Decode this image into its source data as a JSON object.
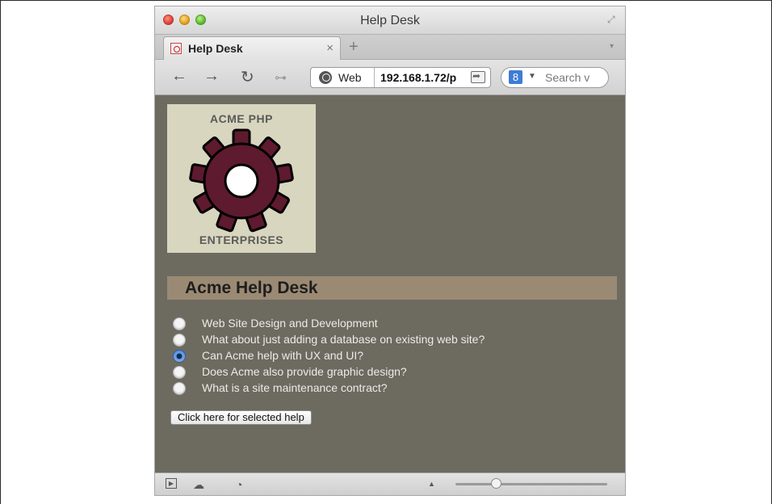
{
  "window": {
    "title": "Help Desk"
  },
  "tabs": [
    {
      "title": "Help Desk",
      "close_label": "×"
    }
  ],
  "tabbar": {
    "new_tab_label": "+",
    "menu_label": "▾"
  },
  "toolbar": {
    "back_label": "←",
    "forward_label": "→",
    "reload_label": "↻",
    "key_label": "⊶",
    "address": {
      "scheme_label": "Web",
      "url": "192.168.1.72/p"
    },
    "search": {
      "engine_label": "8",
      "placeholder": "Search v"
    }
  },
  "page": {
    "logo": {
      "top_text": "ACME PHP",
      "bottom_text": "ENTERPRISES",
      "gear_color": "#5e1a2e"
    },
    "heading": "Acme Help Desk",
    "options": [
      {
        "label": "Web Site Design and Development",
        "checked": false
      },
      {
        "label": "What about just adding a database on existing web site?",
        "checked": false
      },
      {
        "label": "Can Acme help with UX and UI?",
        "checked": true
      },
      {
        "label": "Does Acme also provide graphic design?",
        "checked": false
      },
      {
        "label": "What is a site maintenance contract?",
        "checked": false
      }
    ],
    "submit_label": "Click here for selected help",
    "colors": {
      "background": "#6d6a60",
      "heading_bar": "#9b8a73",
      "logo_bg": "#d8d6be"
    }
  },
  "statusbar": {
    "icons": [
      "play-icon",
      "cloud-icon",
      "gauge-icon",
      "triangle-up-icon"
    ]
  }
}
